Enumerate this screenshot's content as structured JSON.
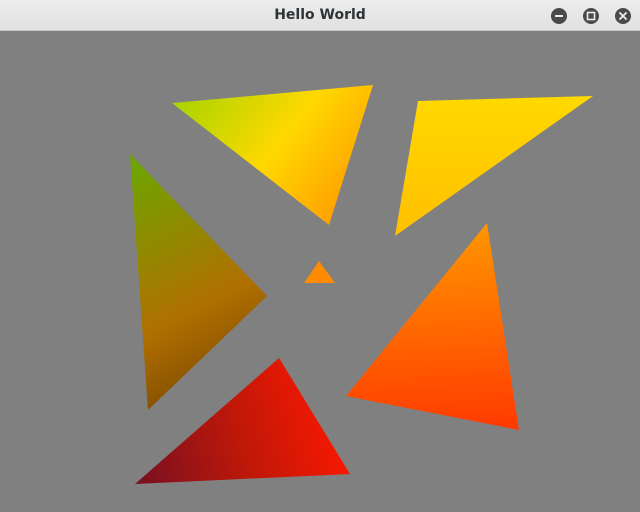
{
  "window": {
    "title": "Hello World"
  },
  "controls": {
    "minimize_icon": "minimize-icon",
    "maximize_icon": "maximize-icon",
    "close_icon": "close-icon"
  },
  "colors": {
    "canvas_background": "#808080",
    "green": "#6aa800",
    "yellow": "#ffd800",
    "orange": "#ff9800",
    "red": "#ff1800",
    "dark_red": "#7a1020"
  }
}
